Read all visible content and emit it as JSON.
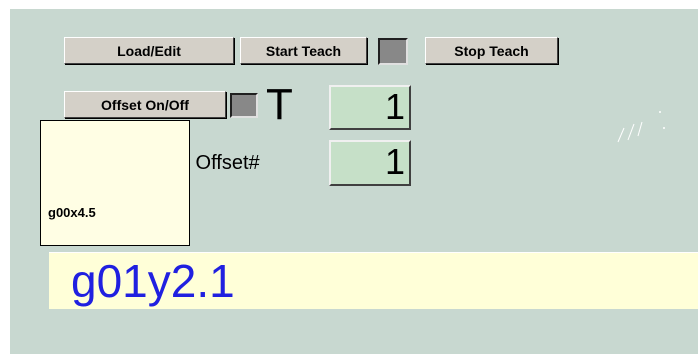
{
  "buttons": {
    "load_edit": "Load/Edit",
    "start_teach": "Start Teach",
    "stop_teach": "Stop Teach",
    "offset_on_off": "Offset On/Off"
  },
  "tool": {
    "letter": "T",
    "value": "1"
  },
  "offset": {
    "label": "k Offset#",
    "value": "1"
  },
  "tooltip": {
    "text": "g00x4.5"
  },
  "current_line": {
    "text": "g01y2.1"
  },
  "colors": {
    "panel": "#c8d8d0",
    "numeric_field": "#c6e0c8",
    "tooltip_bg": "#fffee4",
    "code_bg": "#ffffd8",
    "code_text": "#2020e0",
    "indicator": "#888888"
  }
}
